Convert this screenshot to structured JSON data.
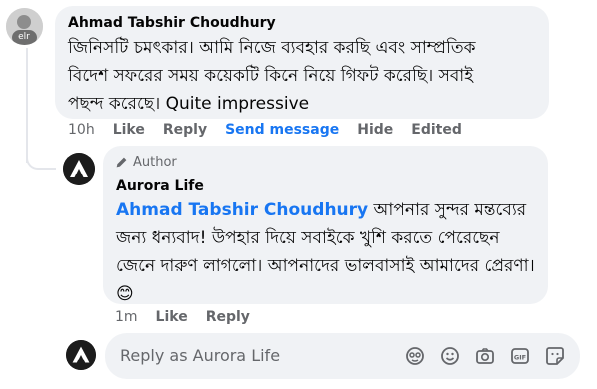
{
  "comment": {
    "author": "Ahmad Tabshir Choudhury",
    "text": "জিনিসটি চমৎকার। আমি নিজে ব্যবহার করছি এবং সাম্প্রতিক বিদেশ সফরের সময় কয়েকটি কিনে নিয়ে গিফট করেছি। সবাই পছন্দ করেছে। Quite impressive",
    "time": "10h",
    "like_label": "Like",
    "reply_label": "Reply",
    "send_message_label": "Send message",
    "hide_label": "Hide",
    "edited_label": "Edited"
  },
  "reply": {
    "badge": "Author",
    "author": "Aurora Life",
    "mention": "Ahmad Tabshir Choudhury",
    "text": "আপনার সুন্দর মন্তব্যের জন্য ধন্যবাদ! উপহার দিয়ে সবাইকে খুশি করতে পেরেছেন জেনে দারুণ লাগলো। আপনাদের ভালবাসাই আমাদের প্রেরণা।",
    "emoji": "😊",
    "time": "1m",
    "like_label": "Like",
    "reply_label": "Reply"
  },
  "composer": {
    "placeholder": "Reply as Aurora Life",
    "icons": [
      "avatar-sticker-icon",
      "emoji-icon",
      "camera-icon",
      "gif-icon",
      "sticker-icon"
    ]
  },
  "colors": {
    "bubble": "#f0f2f5",
    "link_blue": "#1876f2",
    "secondary_text": "#65676b"
  }
}
